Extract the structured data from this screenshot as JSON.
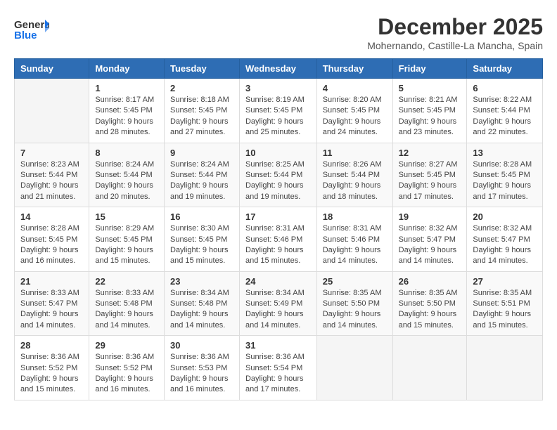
{
  "logo": {
    "general": "General",
    "blue": "Blue"
  },
  "title": "December 2025",
  "location": "Mohernando, Castille-La Mancha, Spain",
  "weekdays": [
    "Sunday",
    "Monday",
    "Tuesday",
    "Wednesday",
    "Thursday",
    "Friday",
    "Saturday"
  ],
  "weeks": [
    [
      {
        "day": "",
        "info": ""
      },
      {
        "day": "1",
        "info": "Sunrise: 8:17 AM\nSunset: 5:45 PM\nDaylight: 9 hours\nand 28 minutes."
      },
      {
        "day": "2",
        "info": "Sunrise: 8:18 AM\nSunset: 5:45 PM\nDaylight: 9 hours\nand 27 minutes."
      },
      {
        "day": "3",
        "info": "Sunrise: 8:19 AM\nSunset: 5:45 PM\nDaylight: 9 hours\nand 25 minutes."
      },
      {
        "day": "4",
        "info": "Sunrise: 8:20 AM\nSunset: 5:45 PM\nDaylight: 9 hours\nand 24 minutes."
      },
      {
        "day": "5",
        "info": "Sunrise: 8:21 AM\nSunset: 5:45 PM\nDaylight: 9 hours\nand 23 minutes."
      },
      {
        "day": "6",
        "info": "Sunrise: 8:22 AM\nSunset: 5:44 PM\nDaylight: 9 hours\nand 22 minutes."
      }
    ],
    [
      {
        "day": "7",
        "info": "Sunrise: 8:23 AM\nSunset: 5:44 PM\nDaylight: 9 hours\nand 21 minutes."
      },
      {
        "day": "8",
        "info": "Sunrise: 8:24 AM\nSunset: 5:44 PM\nDaylight: 9 hours\nand 20 minutes."
      },
      {
        "day": "9",
        "info": "Sunrise: 8:24 AM\nSunset: 5:44 PM\nDaylight: 9 hours\nand 19 minutes."
      },
      {
        "day": "10",
        "info": "Sunrise: 8:25 AM\nSunset: 5:44 PM\nDaylight: 9 hours\nand 19 minutes."
      },
      {
        "day": "11",
        "info": "Sunrise: 8:26 AM\nSunset: 5:44 PM\nDaylight: 9 hours\nand 18 minutes."
      },
      {
        "day": "12",
        "info": "Sunrise: 8:27 AM\nSunset: 5:45 PM\nDaylight: 9 hours\nand 17 minutes."
      },
      {
        "day": "13",
        "info": "Sunrise: 8:28 AM\nSunset: 5:45 PM\nDaylight: 9 hours\nand 17 minutes."
      }
    ],
    [
      {
        "day": "14",
        "info": "Sunrise: 8:28 AM\nSunset: 5:45 PM\nDaylight: 9 hours\nand 16 minutes."
      },
      {
        "day": "15",
        "info": "Sunrise: 8:29 AM\nSunset: 5:45 PM\nDaylight: 9 hours\nand 15 minutes."
      },
      {
        "day": "16",
        "info": "Sunrise: 8:30 AM\nSunset: 5:45 PM\nDaylight: 9 hours\nand 15 minutes."
      },
      {
        "day": "17",
        "info": "Sunrise: 8:31 AM\nSunset: 5:46 PM\nDaylight: 9 hours\nand 15 minutes."
      },
      {
        "day": "18",
        "info": "Sunrise: 8:31 AM\nSunset: 5:46 PM\nDaylight: 9 hours\nand 14 minutes."
      },
      {
        "day": "19",
        "info": "Sunrise: 8:32 AM\nSunset: 5:47 PM\nDaylight: 9 hours\nand 14 minutes."
      },
      {
        "day": "20",
        "info": "Sunrise: 8:32 AM\nSunset: 5:47 PM\nDaylight: 9 hours\nand 14 minutes."
      }
    ],
    [
      {
        "day": "21",
        "info": "Sunrise: 8:33 AM\nSunset: 5:47 PM\nDaylight: 9 hours\nand 14 minutes."
      },
      {
        "day": "22",
        "info": "Sunrise: 8:33 AM\nSunset: 5:48 PM\nDaylight: 9 hours\nand 14 minutes."
      },
      {
        "day": "23",
        "info": "Sunrise: 8:34 AM\nSunset: 5:48 PM\nDaylight: 9 hours\nand 14 minutes."
      },
      {
        "day": "24",
        "info": "Sunrise: 8:34 AM\nSunset: 5:49 PM\nDaylight: 9 hours\nand 14 minutes."
      },
      {
        "day": "25",
        "info": "Sunrise: 8:35 AM\nSunset: 5:50 PM\nDaylight: 9 hours\nand 14 minutes."
      },
      {
        "day": "26",
        "info": "Sunrise: 8:35 AM\nSunset: 5:50 PM\nDaylight: 9 hours\nand 15 minutes."
      },
      {
        "day": "27",
        "info": "Sunrise: 8:35 AM\nSunset: 5:51 PM\nDaylight: 9 hours\nand 15 minutes."
      }
    ],
    [
      {
        "day": "28",
        "info": "Sunrise: 8:36 AM\nSunset: 5:52 PM\nDaylight: 9 hours\nand 15 minutes."
      },
      {
        "day": "29",
        "info": "Sunrise: 8:36 AM\nSunset: 5:52 PM\nDaylight: 9 hours\nand 16 minutes."
      },
      {
        "day": "30",
        "info": "Sunrise: 8:36 AM\nSunset: 5:53 PM\nDaylight: 9 hours\nand 16 minutes."
      },
      {
        "day": "31",
        "info": "Sunrise: 8:36 AM\nSunset: 5:54 PM\nDaylight: 9 hours\nand 17 minutes."
      },
      {
        "day": "",
        "info": ""
      },
      {
        "day": "",
        "info": ""
      },
      {
        "day": "",
        "info": ""
      }
    ]
  ]
}
